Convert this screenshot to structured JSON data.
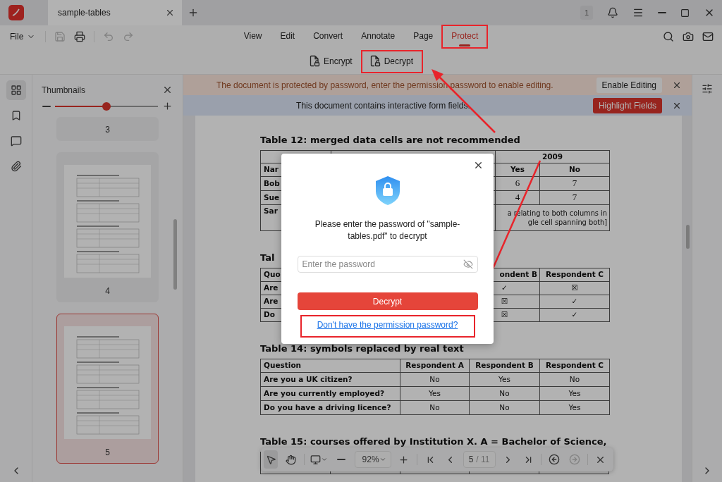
{
  "tab_bar": {
    "tabs": [
      {
        "title": "sample-tables",
        "selected": true
      }
    ],
    "notification_count": "1"
  },
  "menu_bar": {
    "file": "File",
    "menus": [
      {
        "label": "View",
        "selected": false,
        "annotated": false
      },
      {
        "label": "Edit",
        "selected": false,
        "annotated": false
      },
      {
        "label": "Convert",
        "selected": false,
        "annotated": false
      },
      {
        "label": "Annotate",
        "selected": false,
        "annotated": false
      },
      {
        "label": "Page",
        "selected": false,
        "annotated": false
      },
      {
        "label": "Protect",
        "selected": true,
        "annotated": true
      }
    ]
  },
  "ribbon": [
    {
      "kind": "encrypt",
      "label": "Encrypt",
      "annotated": false
    },
    {
      "kind": "decrypt",
      "label": "Decrypt",
      "annotated": true
    }
  ],
  "side_rail": [
    {
      "kind": "thumbnails",
      "selected": true
    },
    {
      "kind": "bookmarks",
      "selected": false
    },
    {
      "kind": "comments",
      "selected": false
    },
    {
      "kind": "attachments",
      "selected": false
    }
  ],
  "thumbnails": {
    "title": "Thumbnails",
    "zoom": {
      "level": 0.5
    },
    "pages": [
      {
        "label": "3",
        "kind": "cropped",
        "selected": false
      },
      {
        "label": "4",
        "kind": "full",
        "selected": false
      },
      {
        "label": "5",
        "kind": "full",
        "selected": true
      }
    ]
  },
  "banners": [
    {
      "kind": "warning",
      "message": "The document is protected by password, enter the permission password to enable editing.",
      "button": "Enable Editing"
    },
    {
      "kind": "info",
      "message": "This document contains interactive form fields.",
      "button": "Highlight Fields"
    }
  ],
  "document": {
    "sections": [
      {
        "kind": "merged",
        "title": "Table 12: merged data cells are not recommended",
        "year": "2009",
        "corner": "Nar",
        "subheads": [
          "Yes",
          "No"
        ],
        "rows": [
          {
            "label": "Bob",
            "values": [
              "6",
              "7"
            ]
          },
          {
            "label": "Sue",
            "values": [
              "4",
              "7"
            ]
          }
        ],
        "last": {
          "label": "Sar",
          "note": [
            "a relating to both columns in",
            "gle cell spanning both]"
          ]
        }
      },
      {
        "kind": "covered",
        "title": "Tal",
        "columns": [
          "Quo",
          "ondent B",
          "Respondent C"
        ],
        "rows": [
          [
            "Are",
            "✓",
            "☒"
          ],
          [
            "Are",
            "☒",
            "✓"
          ],
          [
            "Do",
            "☒",
            "✓"
          ]
        ]
      },
      {
        "kind": "full",
        "title": "Table 14: symbols replaced by real text",
        "columns": [
          "Question",
          "Respondent A",
          "Respondent B",
          "Respondent C"
        ],
        "rows": [
          [
            "Are you a UK citizen?",
            "No",
            "Yes",
            "No"
          ],
          [
            "Are you currently employed?",
            "Yes",
            "No",
            "Yes"
          ],
          [
            "Do you have a driving licence?",
            "No",
            "No",
            "Yes"
          ]
        ]
      },
      {
        "kind": "cut",
        "title": "Table 15: courses offered by Institution X. A = Bachelor of Science,"
      }
    ]
  },
  "page_toolbar": {
    "tools": [
      {
        "kind": "select",
        "selected": true
      },
      {
        "kind": "hand",
        "selected": false
      }
    ],
    "zoom": "92%",
    "page": "5",
    "page_count": "/ 11",
    "back": {
      "disabled": false
    },
    "forward": {
      "disabled": true
    }
  },
  "dialog": {
    "message": "Please enter the password of \"sample-tables.pdf\" to decrypt",
    "placeholder": "Enter the password",
    "button": "Decrypt",
    "link": "Don't have the permission password?",
    "link_annotated": true
  }
}
